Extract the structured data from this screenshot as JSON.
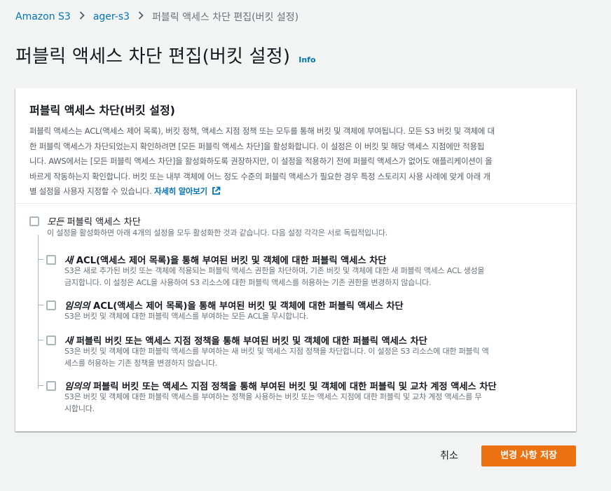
{
  "breadcrumb": {
    "items": [
      "Amazon S3",
      "ager-s3"
    ],
    "current": "퍼블릭 액세스 차단 편집(버킷 설정)"
  },
  "header": {
    "title": "퍼블릭 액세스 차단 편집(버킷 설정)",
    "info": "Info"
  },
  "card": {
    "title": "퍼블릭 액세스 차단(버킷 설정)",
    "description_lines": [
      "퍼블릭 액세스는 ACL(액세스 제어 목록), 버킷 정책, 액세스 지점 정책 또는 모두를 통해 버킷 및 객체에 부여됩니다. 모든 S3 버킷 및 객체에 대",
      "한 퍼블릭 액세스가 차단되었는지 확인하려면 [모든 퍼블릭 액세스 차단]을 활성화합니다. 이 설정은 이 버킷 및 해당 액세스 지점에만 적용됩",
      "니다. AWS에서는 [모든 퍼블릭 액세스 차단]을 활성화하도록 권장하지만, 이 설정을 적용하기 전에 퍼블릭 액세스가 없어도 애플리케이션이 올",
      "바르게 작동하는지 확인합니다. 버킷 또는 내부 객체에 어느 정도 수준의 퍼블릭 액세스가 필요한 경우 특정 스토리지 사용 사례에 맞게 아래 개",
      "별 설정을 사용자 지정할 수 있습니다."
    ],
    "learn_more": "자세히 알아보기",
    "external_icon": "external-link-icon"
  },
  "options": {
    "all": {
      "label_em": "모든",
      "label_rest": " 퍼블릭 액세스 차단",
      "desc": "이 설정을 활성화하면 아래 4개의 설정을 모두 활성화한 것과 같습니다. 다음 설정 각각은 서로 독립적입니다.",
      "checked": false
    },
    "sub": [
      {
        "label_em": "새",
        "label_rest": " ACL(액세스 제어 목록)을 통해 부여된 버킷 및 객체에 대한 퍼블릭 액세스 차단",
        "desc_lines": [
          "S3은 새로 추가된 버킷 또는 객체에 적용되는 퍼블릭 액세스 권한을 차단하며, 기존 버킷 및 객체에 대한 새 퍼블릭 액세스 ACL 생성을",
          "금지합니다. 이 설정은 ACL을 사용하여 S3 리소스에 대한 퍼블릭 액세스를 허용하는 기존 권한을 변경하지 않습니다."
        ],
        "checked": false
      },
      {
        "label_em": "임의의",
        "label_rest": " ACL(액세스 제어 목록)을 통해 부여된 버킷 및 객체에 대한 퍼블릭 액세스 차단",
        "desc_lines": [
          "S3은 버킷 및 객체에 대한 퍼블릭 액세스를 부여하는 모든 ACL을 무시합니다."
        ],
        "checked": false
      },
      {
        "label_em": "새",
        "label_rest": " 퍼블릭 버킷 또는 액세스 지점 정책을 통해 부여된 버킷 및 객체에 대한 퍼블릭 액세스 차단",
        "desc_lines": [
          "S3은 버킷 및 객체에 대한 퍼블릭 액세스를 부여하는 새 버킷 및 액세스 지점 정책을 차단합니다. 이 설정은 S3 리소스에 대한 퍼블릭 액",
          "세스를 허용하는 기존 정책을 변경하지 않습니다."
        ],
        "checked": false
      },
      {
        "label_em": "임의의",
        "label_rest": " 퍼블릭 버킷 또는 액세스 지점 정책을 통해 부여된 버킷 및 객체에 대한 퍼블릭 및 교차 계정 액세스 차단",
        "desc_lines": [
          "S3은 버킷 및 객체에 대한 퍼블릭 액세스를 부여하는 정책을 사용하는 버킷 또는 액세스 지점에 대한 퍼블릭 및 교차 계정 액세스를 무",
          "시합니다."
        ],
        "checked": false
      }
    ]
  },
  "footer": {
    "cancel": "취소",
    "save": "변경 사항 저장"
  },
  "colors": {
    "link": "#0073bb",
    "primary_button": "#ec7211",
    "background": "#f2f3f3"
  }
}
